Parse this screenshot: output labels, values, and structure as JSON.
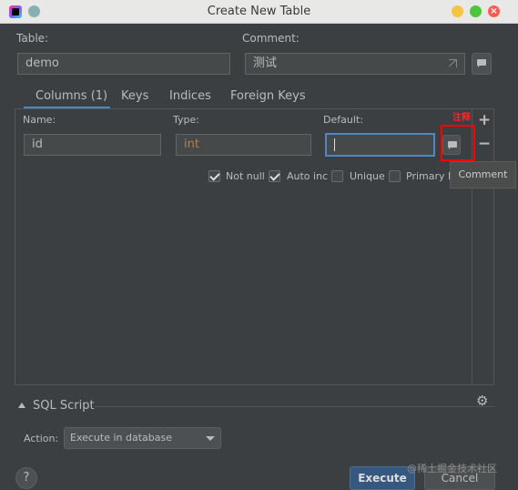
{
  "window": {
    "title": "Create New Table",
    "close_glyph": "×"
  },
  "form": {
    "table_label": "Table:",
    "table_value": "demo",
    "comment_label": "Comment:",
    "comment_value": "测试"
  },
  "tabs": [
    {
      "label": "Columns (1)",
      "active": true
    },
    {
      "label": "Keys",
      "active": false
    },
    {
      "label": "Indices",
      "active": false
    },
    {
      "label": "Foreign Keys",
      "active": false
    }
  ],
  "columns": {
    "name_label": "Name:",
    "name_value": "id",
    "type_label": "Type:",
    "type_value": "int",
    "default_label": "Default:",
    "default_value": "",
    "add_glyph": "+",
    "remove_glyph": "−",
    "options": [
      {
        "label": "Not null",
        "checked": true
      },
      {
        "label": "Auto inc",
        "checked": true
      },
      {
        "label": "Unique",
        "checked": false
      },
      {
        "label": "Primary k",
        "checked": false
      }
    ],
    "tooltip": "Comment",
    "annotation": "注释"
  },
  "sql_script": {
    "section_label": "SQL Script",
    "action_label": "Action:",
    "action_value": "Execute in database"
  },
  "footer": {
    "help_label": "?",
    "execute_label": "Execute",
    "cancel_label": "Cancel",
    "watermark": "@稀土掘金技术社区"
  },
  "colors": {
    "background": "#3c3f41",
    "accent": "#4a88c7",
    "type_text": "#cc7832",
    "annotation": "#ff0000"
  },
  "icons": [
    "app-icon",
    "pin-icon",
    "minimize-icon",
    "maximize-icon",
    "close-icon",
    "expand-icon",
    "comment-bubble-icon",
    "plus-icon",
    "minus-icon",
    "collapse-triangle-icon",
    "gear-icon",
    "dropdown-caret-icon",
    "help-icon"
  ]
}
